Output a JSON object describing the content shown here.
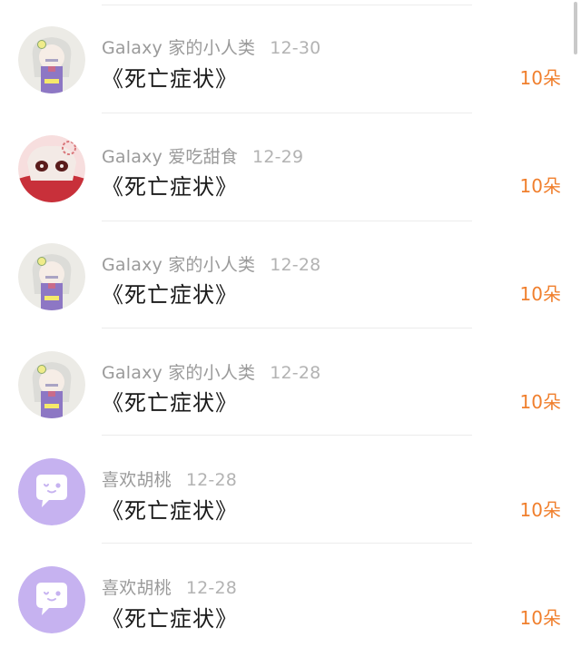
{
  "list": {
    "items": [
      {
        "avatar": "girl-avatar",
        "name": "Galaxy 家的小人类",
        "date": "12-30",
        "title": "《死亡症状》",
        "amount": "10朵"
      },
      {
        "avatar": "sweets-avatar",
        "name": "Galaxy 爱吃甜食",
        "date": "12-29",
        "title": "《死亡症状》",
        "amount": "10朵"
      },
      {
        "avatar": "girl-avatar",
        "name": "Galaxy 家的小人类",
        "date": "12-28",
        "title": "《死亡症状》",
        "amount": "10朵"
      },
      {
        "avatar": "girl-avatar",
        "name": "Galaxy 家的小人类",
        "date": "12-28",
        "title": "《死亡症状》",
        "amount": "10朵"
      },
      {
        "avatar": "chat-bubble-avatar",
        "name": "喜欢胡桃",
        "date": "12-28",
        "title": "《死亡症状》",
        "amount": "10朵"
      },
      {
        "avatar": "chat-bubble-avatar",
        "name": "喜欢胡桃",
        "date": "12-28",
        "title": "《死亡症状》",
        "amount": "10朵"
      }
    ]
  },
  "colors": {
    "accent_amount": "#f07f2d",
    "meta_text": "#9a9a9a",
    "title_text": "#1a1a1a",
    "default_avatar_bg": "#c6b2f0"
  }
}
